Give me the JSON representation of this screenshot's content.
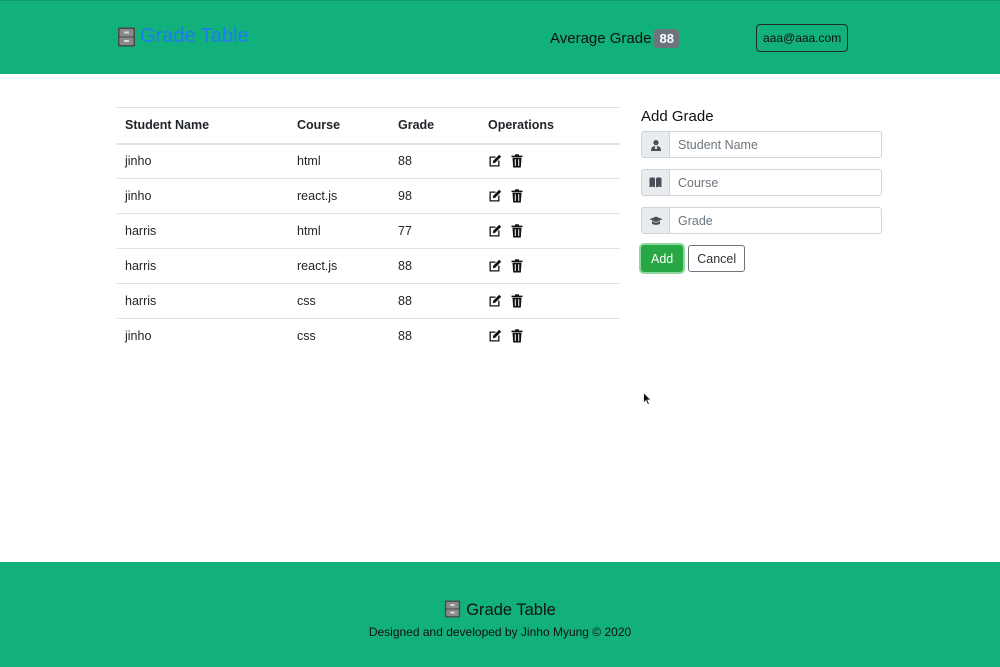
{
  "header": {
    "brand_title": "Grade Table",
    "average_label": "Average Grade",
    "average_value": "88",
    "user_email": "aaa@aaa.com"
  },
  "table": {
    "columns": [
      "Student Name",
      "Course",
      "Grade",
      "Operations"
    ],
    "rows": [
      {
        "name": "jinho",
        "course": "html",
        "grade": "88"
      },
      {
        "name": "jinho",
        "course": "react.js",
        "grade": "98"
      },
      {
        "name": "harris",
        "course": "html",
        "grade": "77"
      },
      {
        "name": "harris",
        "course": "react.js",
        "grade": "88"
      },
      {
        "name": "harris",
        "course": "css",
        "grade": "88"
      },
      {
        "name": "jinho",
        "course": "css",
        "grade": "88"
      }
    ],
    "row_icons": [
      "edit-icon",
      "trash-icon"
    ]
  },
  "form": {
    "title": "Add Grade",
    "name_placeholder": "Student Name",
    "name_value": "",
    "course_placeholder": "Course",
    "course_value": "",
    "grade_placeholder": "Grade",
    "grade_value": "",
    "add_label": "Add",
    "cancel_label": "Cancel"
  },
  "footer": {
    "brand_title": "Grade Table",
    "credit": "Designed and developed by Jinho Myung © 2020"
  },
  "colors": {
    "header_bg": "#12b07a",
    "brand_link": "#1e7cf0",
    "add_button": "#28a745",
    "badge": "#6c757d"
  }
}
